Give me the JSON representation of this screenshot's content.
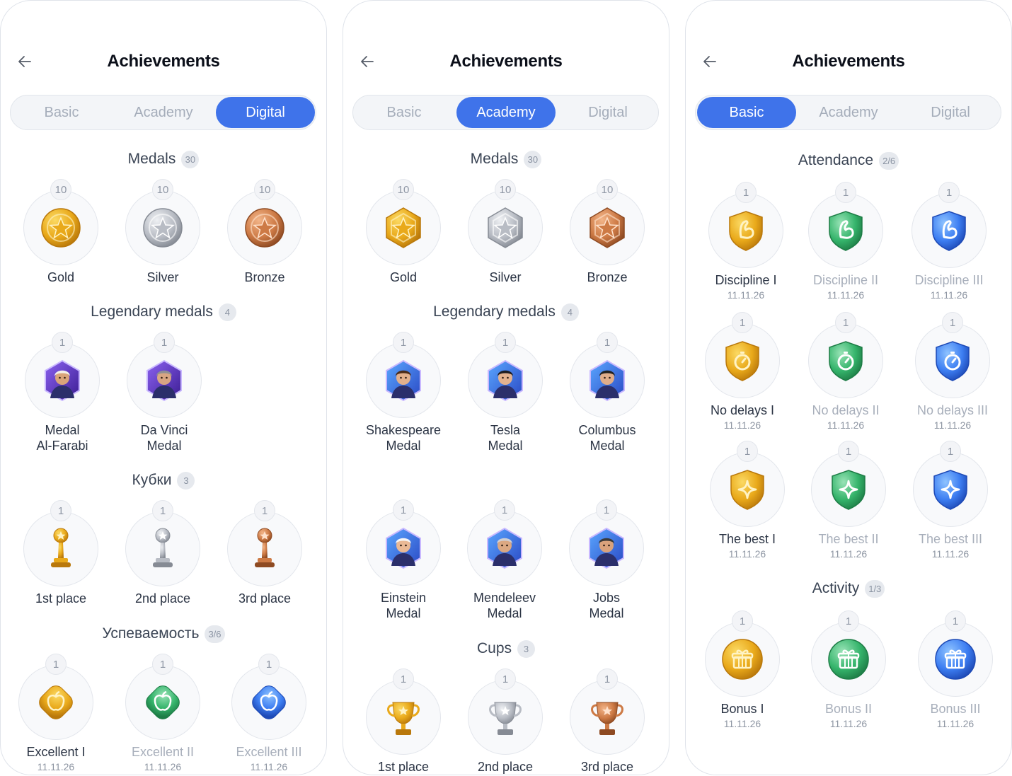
{
  "screens": [
    {
      "title": "Achievements",
      "tabs": [
        "Basic",
        "Academy",
        "Digital"
      ],
      "active_tab": "Digital",
      "sections": [
        {
          "title": "Medals",
          "count": "30",
          "items": [
            {
              "badge": "10",
              "label": "Gold",
              "icon": "gold-star-medal-icon"
            },
            {
              "badge": "10",
              "label": "Silver",
              "icon": "silver-star-medal-icon"
            },
            {
              "badge": "10",
              "label": "Bronze",
              "icon": "bronze-star-medal-icon"
            }
          ]
        },
        {
          "title": "Legendary medals",
          "count": "4",
          "items": [
            {
              "badge": "1",
              "label": "Medal\nAl-Farabi",
              "icon": "al-farabi-portrait-icon"
            },
            {
              "badge": "1",
              "label": "Da Vinci\nMedal",
              "icon": "da-vinci-portrait-icon"
            }
          ]
        },
        {
          "title": "Кубки",
          "count": "3",
          "items": [
            {
              "badge": "1",
              "label": "1st place",
              "icon": "gold-trophy-icon"
            },
            {
              "badge": "1",
              "label": "2nd place",
              "icon": "silver-trophy-icon"
            },
            {
              "badge": "1",
              "label": "3rd place",
              "icon": "bronze-trophy-icon"
            }
          ]
        },
        {
          "title": "Успеваемость",
          "count": "3/6",
          "items": [
            {
              "badge": "1",
              "label": "Excellent I",
              "date": "11.11.26",
              "icon": "gold-apple-icon"
            },
            {
              "badge": "1",
              "label": "Excellent II",
              "date": "11.11.26",
              "icon": "green-apple-icon"
            },
            {
              "badge": "1",
              "label": "Excellent III",
              "date": "11.11.26",
              "icon": "blue-apple-icon"
            }
          ]
        }
      ]
    },
    {
      "title": "Achievements",
      "tabs": [
        "Basic",
        "Academy",
        "Digital"
      ],
      "active_tab": "Academy",
      "sections": [
        {
          "title": "Medals",
          "count": "30",
          "items": [
            {
              "badge": "10",
              "label": "Gold",
              "icon": "gold-hexagon-medal-icon"
            },
            {
              "badge": "10",
              "label": "Silver",
              "icon": "silver-hexagon-medal-icon"
            },
            {
              "badge": "10",
              "label": "Bronze",
              "icon": "bronze-hexagon-medal-icon"
            }
          ]
        },
        {
          "title": "Legendary medals",
          "count": "4",
          "items": [
            {
              "badge": "1",
              "label": "Shakespeare\nMedal",
              "icon": "shakespeare-portrait-icon"
            },
            {
              "badge": "1",
              "label": "Tesla\nMedal",
              "icon": "tesla-portrait-icon"
            },
            {
              "badge": "1",
              "label": "Columbus\nMedal",
              "icon": "columbus-portrait-icon"
            },
            {
              "badge": "1",
              "label": "Einstein\nMedal",
              "icon": "einstein-portrait-icon"
            },
            {
              "badge": "1",
              "label": "Mendeleev\nMedal",
              "icon": "mendeleev-portrait-icon"
            },
            {
              "badge": "1",
              "label": "Jobs\nMedal",
              "icon": "jobs-portrait-icon"
            }
          ]
        },
        {
          "title": "Cups",
          "count": "3",
          "items": [
            {
              "badge": "1",
              "label": "1st place",
              "icon": "gold-cup-icon"
            },
            {
              "badge": "1",
              "label": "2nd place",
              "icon": "silver-cup-icon"
            },
            {
              "badge": "1",
              "label": "3rd place",
              "icon": "bronze-cup-icon"
            }
          ]
        }
      ]
    },
    {
      "title": "Achievements",
      "tabs": [
        "Basic",
        "Academy",
        "Digital"
      ],
      "active_tab": "Basic",
      "sections": [
        {
          "title": "Attendance",
          "count": "2/6",
          "items": [
            {
              "badge": "1",
              "label": "Discipline I",
              "date": "11.11.26",
              "icon": "gold-bicep-shield-icon"
            },
            {
              "badge": "1",
              "label": "Discipline II",
              "date": "11.11.26",
              "icon": "green-bicep-shield-icon"
            },
            {
              "badge": "1",
              "label": "Discipline III",
              "date": "11.11.26",
              "icon": "blue-bicep-shield-icon"
            },
            {
              "badge": "1",
              "label": "No delays I",
              "date": "11.11.26",
              "icon": "gold-stopwatch-shield-icon"
            },
            {
              "badge": "1",
              "label": "No delays II",
              "date": "11.11.26",
              "icon": "green-stopwatch-shield-icon"
            },
            {
              "badge": "1",
              "label": "No delays III",
              "date": "11.11.26",
              "icon": "blue-stopwatch-shield-icon"
            },
            {
              "badge": "1",
              "label": "The best I",
              "date": "11.11.26",
              "icon": "gold-sparkle-shield-icon"
            },
            {
              "badge": "1",
              "label": "The best II",
              "date": "11.11.26",
              "icon": "green-sparkle-shield-icon"
            },
            {
              "badge": "1",
              "label": "The best III",
              "date": "11.11.26",
              "icon": "blue-sparkle-shield-icon"
            }
          ]
        },
        {
          "title": "Activity",
          "count": "1/3",
          "items": [
            {
              "badge": "1",
              "label": "Bonus I",
              "date": "11.11.26",
              "icon": "gold-gift-coin-icon"
            },
            {
              "badge": "1",
              "label": "Bonus II",
              "date": "11.11.26",
              "icon": "green-gift-coin-icon"
            },
            {
              "badge": "1",
              "label": "Bonus III",
              "date": "11.11.26",
              "icon": "blue-gift-coin-icon"
            }
          ]
        }
      ]
    }
  ]
}
